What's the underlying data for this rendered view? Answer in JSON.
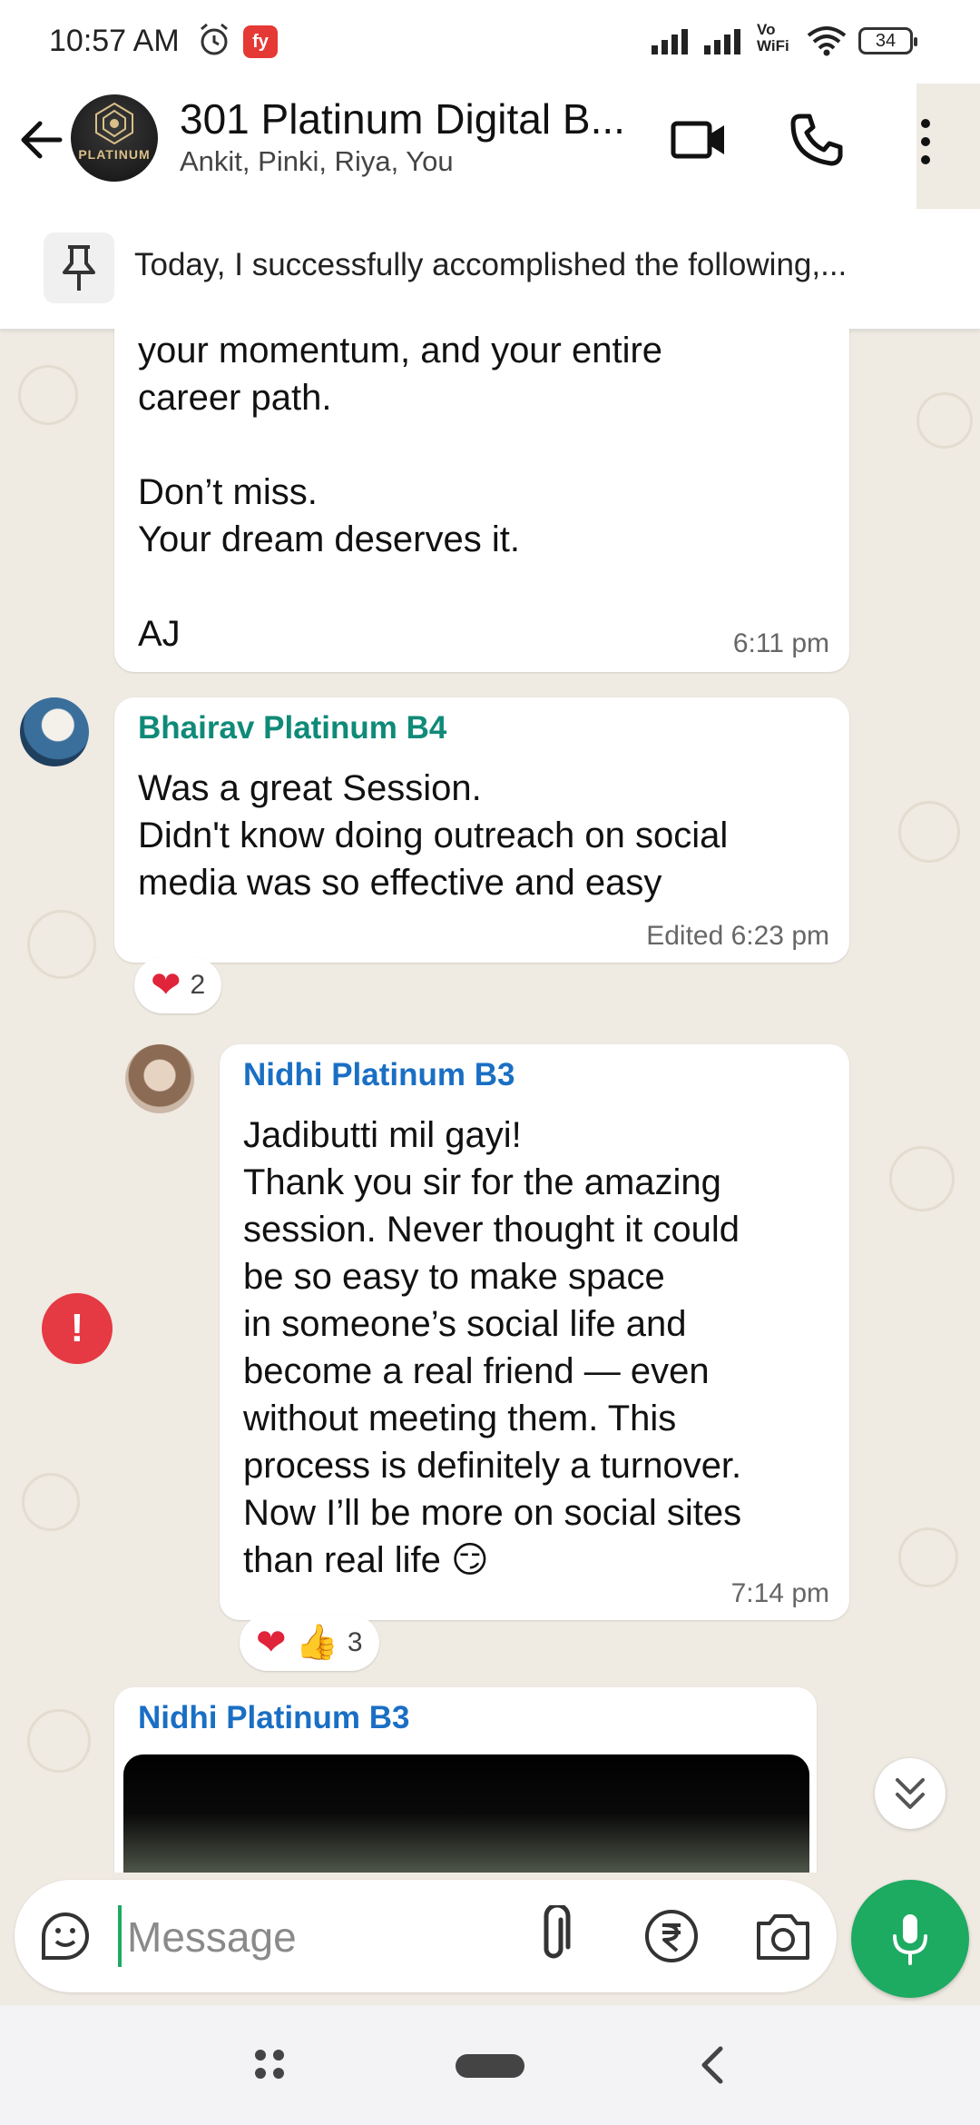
{
  "status_bar": {
    "time": "10:57 AM",
    "network_label": "Vo\nWiFi",
    "battery": "34"
  },
  "header": {
    "title": "301 Platinum Digital B...",
    "subtitle": "Ankit, Pinki, Riya, You",
    "avatar_text": "PLATINUM"
  },
  "pinned": {
    "text": "Today, I successfully accomplished the following,..."
  },
  "messages": [
    {
      "text": "your momentum, and your entire\ncareer path.\n\nDon’t miss.\nYour dream deserves it.\n\nAJ",
      "time": "6:11 pm"
    },
    {
      "sender": "Bhairav Platinum B4",
      "sender_color": "#0f8a78",
      "text": "Was a great Session.\nDidn't know doing outreach on social\nmedia was so effective and easy",
      "time": "Edited 6:23 pm",
      "reaction_count": "2"
    },
    {
      "sender": "Nidhi Platinum B3",
      "sender_color": "#1a6fc4",
      "text": "Jadibutti mil gayi!\nThank you sir for the amazing\nsession. Never thought it could\nbe so easy to make space\nin someone’s social life and\nbecome a real friend — even\nwithout meeting them. This\nprocess is definitely a turnover.\nNow I’ll be more on social sites\nthan real life 😏",
      "time": "7:14 pm",
      "reaction_count": "3"
    },
    {
      "sender": "Nidhi Platinum B3",
      "sender_color": "#1a6fc4"
    }
  ],
  "error_icon": "!",
  "input": {
    "placeholder": "Message"
  },
  "colors": {
    "accent": "#1daa61",
    "error": "#e53943",
    "chat_bg": "#efeae2"
  }
}
